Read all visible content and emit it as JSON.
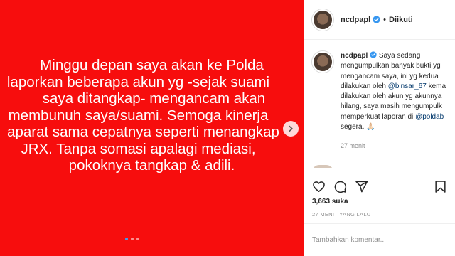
{
  "post_image": {
    "background_color": "#f70d0d",
    "lines": [
      "Minggu depan saya akan ke Polda",
      "laporkan beberapa akun yg -sejak suami",
      "saya ditangkap- mengancam akan",
      "membunuh saya/suami. Semoga kinerja",
      "aparat sama cepatnya seperti menangkap",
      "JRX. Tanpa somasi apalagi mediasi,",
      "pokoknya tangkap & adili."
    ],
    "carousel_dots": 3,
    "carousel_active_index": 0,
    "next_icon": "chevron-right-icon"
  },
  "header": {
    "username": "ncdpapl",
    "verified_icon": "verified-badge-icon",
    "separator": "•",
    "follow_state": "Diikuti"
  },
  "caption": {
    "username": "ncdpapl",
    "lines": [
      "Saya sedang",
      "mengumpulkan banyak bukti yg",
      "mengancam saya, ini yg kedua",
      "dilakukan oleh ",
      "dilakukan oleh akun yg akunnya",
      "hilang, saya masih mengumpulk",
      "memperkuat laporan di ",
      "segera. 🙏🏻"
    ],
    "mention_1": "@binsar_67",
    "mention_1_suffix": " kema",
    "mention_2": "@poldab",
    "timestamp": "27 menit"
  },
  "actions": {
    "like_icon": "heart-icon",
    "comment_icon": "comment-icon",
    "share_icon": "share-icon",
    "save_icon": "bookmark-icon"
  },
  "likes_text": "3,663 suka",
  "post_time": "27 MENIT YANG LALU",
  "comment_box": {
    "placeholder": "Tambahkan komentar..."
  }
}
